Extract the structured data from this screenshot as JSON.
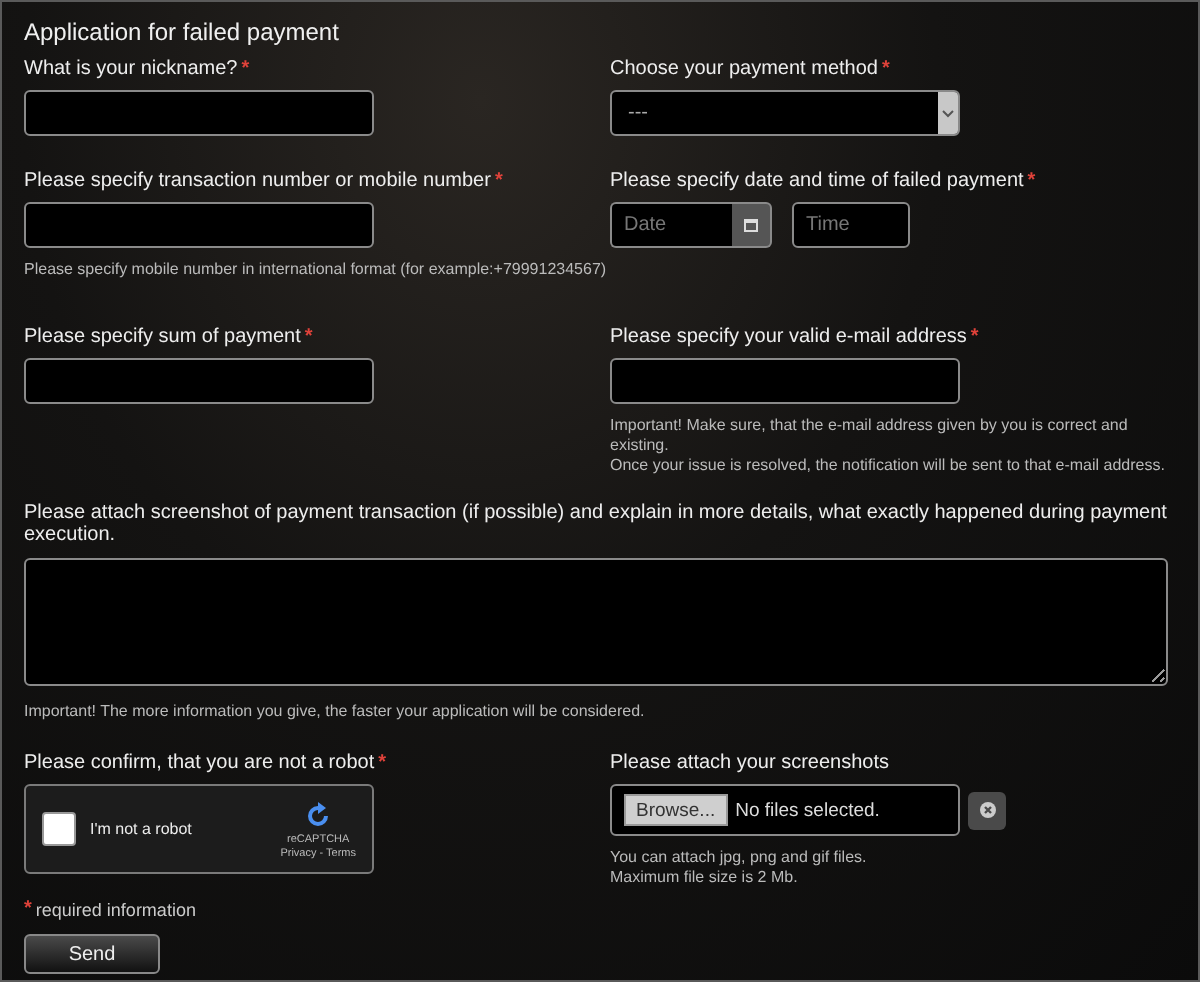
{
  "title": "Application for failed payment",
  "nickname": {
    "label": "What is your nickname?",
    "mark": "*"
  },
  "payment_method": {
    "label": "Choose your payment method",
    "mark": "*",
    "value": "---"
  },
  "transaction": {
    "label": "Please specify transaction number or mobile number",
    "mark": "*",
    "hint": "Please specify mobile number in international format (for example:+79991234567)"
  },
  "date_time": {
    "label": "Please specify date and time of failed payment",
    "mark": "*",
    "date_placeholder": "Date",
    "time_placeholder": "Time"
  },
  "sum": {
    "label": "Please specify sum of payment",
    "mark": "*"
  },
  "email": {
    "label": "Please specify your valid e-mail address",
    "mark": "*",
    "notes": [
      "Important! Make sure, that the e-mail address given by you is correct and existing.",
      "Once your issue is resolved, the notification will be sent to that e-mail address."
    ]
  },
  "details": {
    "label": "Please attach screenshot of payment transaction (if possible) and explain in more details, what exactly happened during payment execution.",
    "note": "Important! The more information you give, the faster your application will be considered."
  },
  "robot": {
    "label": "Please confirm, that you are not a robot",
    "mark": "*",
    "checkbox_label": "I'm not a robot",
    "checked": false,
    "brand": "reCAPTCHA",
    "links": "Privacy - Terms"
  },
  "attach": {
    "label": "Please attach your screenshots",
    "browse": "Browse...",
    "status": "No files selected.",
    "notes": [
      "You can attach jpg, png and gif files.",
      "Maximum file size is 2 Mb."
    ]
  },
  "required_note": {
    "mark": "*",
    "text": "required information"
  },
  "send": "Send"
}
